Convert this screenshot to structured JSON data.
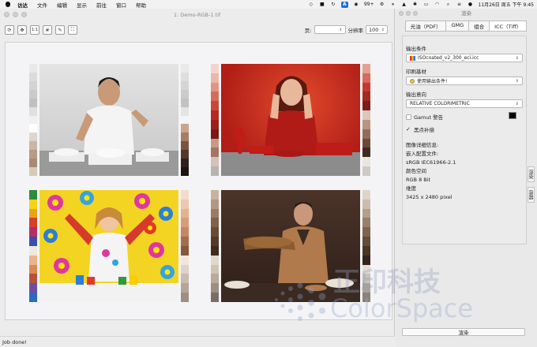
{
  "menubar": {
    "items": [
      "访达",
      "文件",
      "编辑",
      "显示",
      "前往",
      "窗口",
      "帮助"
    ],
    "right_badge": "A",
    "right_text_99": "99+",
    "datetime": "11月26日 周五 下午 9:45"
  },
  "window": {
    "title": "1: Demo-RGB-1.tif"
  },
  "toolbar": {
    "btn_refresh": "⟳",
    "btn_move": "✥",
    "btn_1to1": "1:1",
    "btn_grid": "#",
    "btn_picker": "✎",
    "btn_fit": "⛶",
    "page_label": "页:",
    "page_value": "",
    "resolution_label": "分辨率",
    "resolution_value": "100"
  },
  "status": {
    "text": "Job done!"
  },
  "panel": {
    "title": "渲染",
    "tabs": [
      "光油（PDF）",
      "GMG",
      "组合",
      "ICC（Tiff）"
    ],
    "active_tab": "ICC（Tiff）",
    "output_condition_label": "输出条件",
    "output_condition_value": "ISOcoated_v2_300_eci.icc",
    "print_substrate_label": "印刷基材",
    "print_substrate_value": "使用输出条件!",
    "output_intent_label": "输出意向",
    "output_intent_value": "RELATIVE COLORIMETRIC",
    "gamut_warning_label": "Gamut 警告",
    "black_point_label": "黑点补偿",
    "info_title": "图像详细信息:",
    "embedded_profile_label": "嵌入配置文件:",
    "embedded_profile_value": "sRGB IEC61966-2.1",
    "color_space_label": "颜色空间",
    "color_space_value": "RGB 8 Bit",
    "size_label": "维度",
    "size_value": "3425 x 2480 pixel",
    "side_tab_1": "渲染",
    "side_tab_2": "容器",
    "render_button": "渲染"
  },
  "watermark": {
    "cn": "正印科技",
    "en": "ColorSpace"
  },
  "colors": {
    "canvas_bg": "#f4f4f6",
    "photo_red_bg": "#c8281e",
    "photo_white_bg": "#d8d8d8",
    "photo_yellow_bg": "#f5d81a",
    "photo_brown_bg": "#3c2a22"
  }
}
